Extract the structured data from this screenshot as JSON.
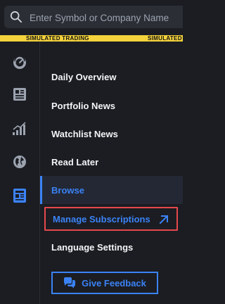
{
  "search": {
    "placeholder": "Enter Symbol or Company Name",
    "icon": "search-icon"
  },
  "banner": {
    "text_left": "SIMULATED TRADING",
    "text_right": "SIMULATED",
    "color": "#f4d23c"
  },
  "rail": {
    "icons": [
      "dashboard-gauge-icon",
      "news-card-icon",
      "bar-chart-icon",
      "globe-icon",
      "newspaper-icon"
    ],
    "active": "newspaper-icon"
  },
  "menu": {
    "items": [
      {
        "label": "Daily Overview"
      },
      {
        "label": "Portfolio News"
      },
      {
        "label": "Watchlist News"
      },
      {
        "label": "Read Later"
      },
      {
        "label": "Browse",
        "selected": true
      },
      {
        "label": "Manage Subscriptions",
        "external": true
      },
      {
        "label": "Language Settings"
      }
    ],
    "feedback_label": "Give Feedback"
  },
  "colors": {
    "accent": "#3b82f6",
    "highlight_border": "#e5484d",
    "background": "#1b1d22"
  }
}
